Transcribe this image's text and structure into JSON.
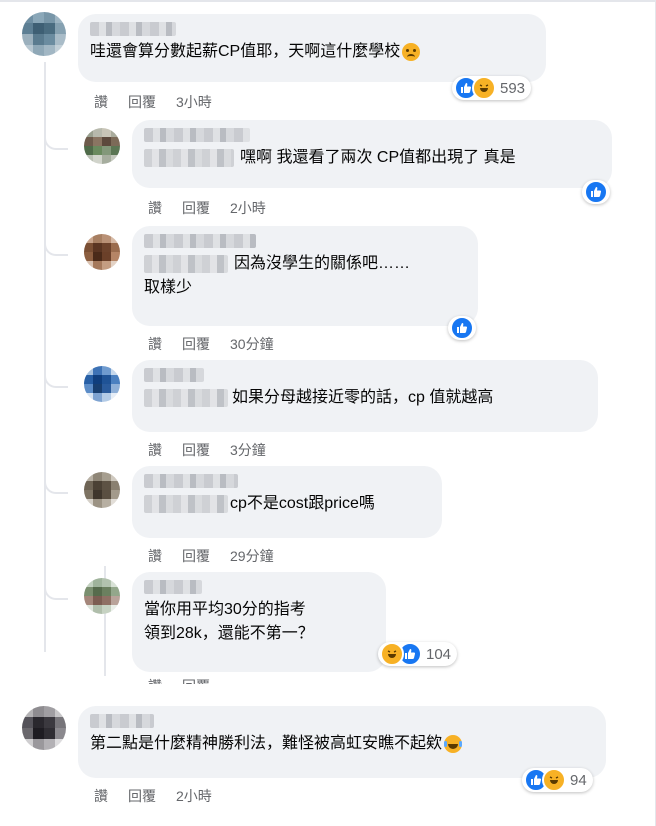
{
  "actions": {
    "like": "讚",
    "reply": "回覆"
  },
  "comments": [
    {
      "text": "哇還會算分數起薪CP值耶，天啊這什麼學校",
      "time": "3小時",
      "reactions": [
        "like",
        "haha"
      ],
      "count": "593"
    },
    {
      "text": "嘿啊 我還看了兩次 CP值都出現了 真是",
      "time": "2小時",
      "reactions": [
        "like"
      ],
      "count": ""
    },
    {
      "text_line1": "因為沒學生的關係吧……",
      "text_line2": "取樣少",
      "time": "30分鐘",
      "reactions": [
        "like"
      ],
      "count": ""
    },
    {
      "text": "如果分母越接近零的話，cp 值就越高",
      "time": "3分鐘"
    },
    {
      "text": "cp不是cost跟price嗎",
      "time": "29分鐘"
    },
    {
      "text_line1": "當你用平均30分的指考",
      "text_line2": "領到28k，還能不第一？",
      "time": "",
      "reactions": [
        "haha",
        "like"
      ],
      "count": "104"
    },
    {
      "text": "第二點是什麼精神勝利法，難怪被高虹安瞧不起欸",
      "time": "2小時",
      "reactions": [
        "like",
        "haha"
      ],
      "count": "94"
    }
  ],
  "colors": {
    "like": "#1877f2",
    "haha": "#f7b125",
    "bubble": "#f0f2f5",
    "meta": "#65676b"
  }
}
